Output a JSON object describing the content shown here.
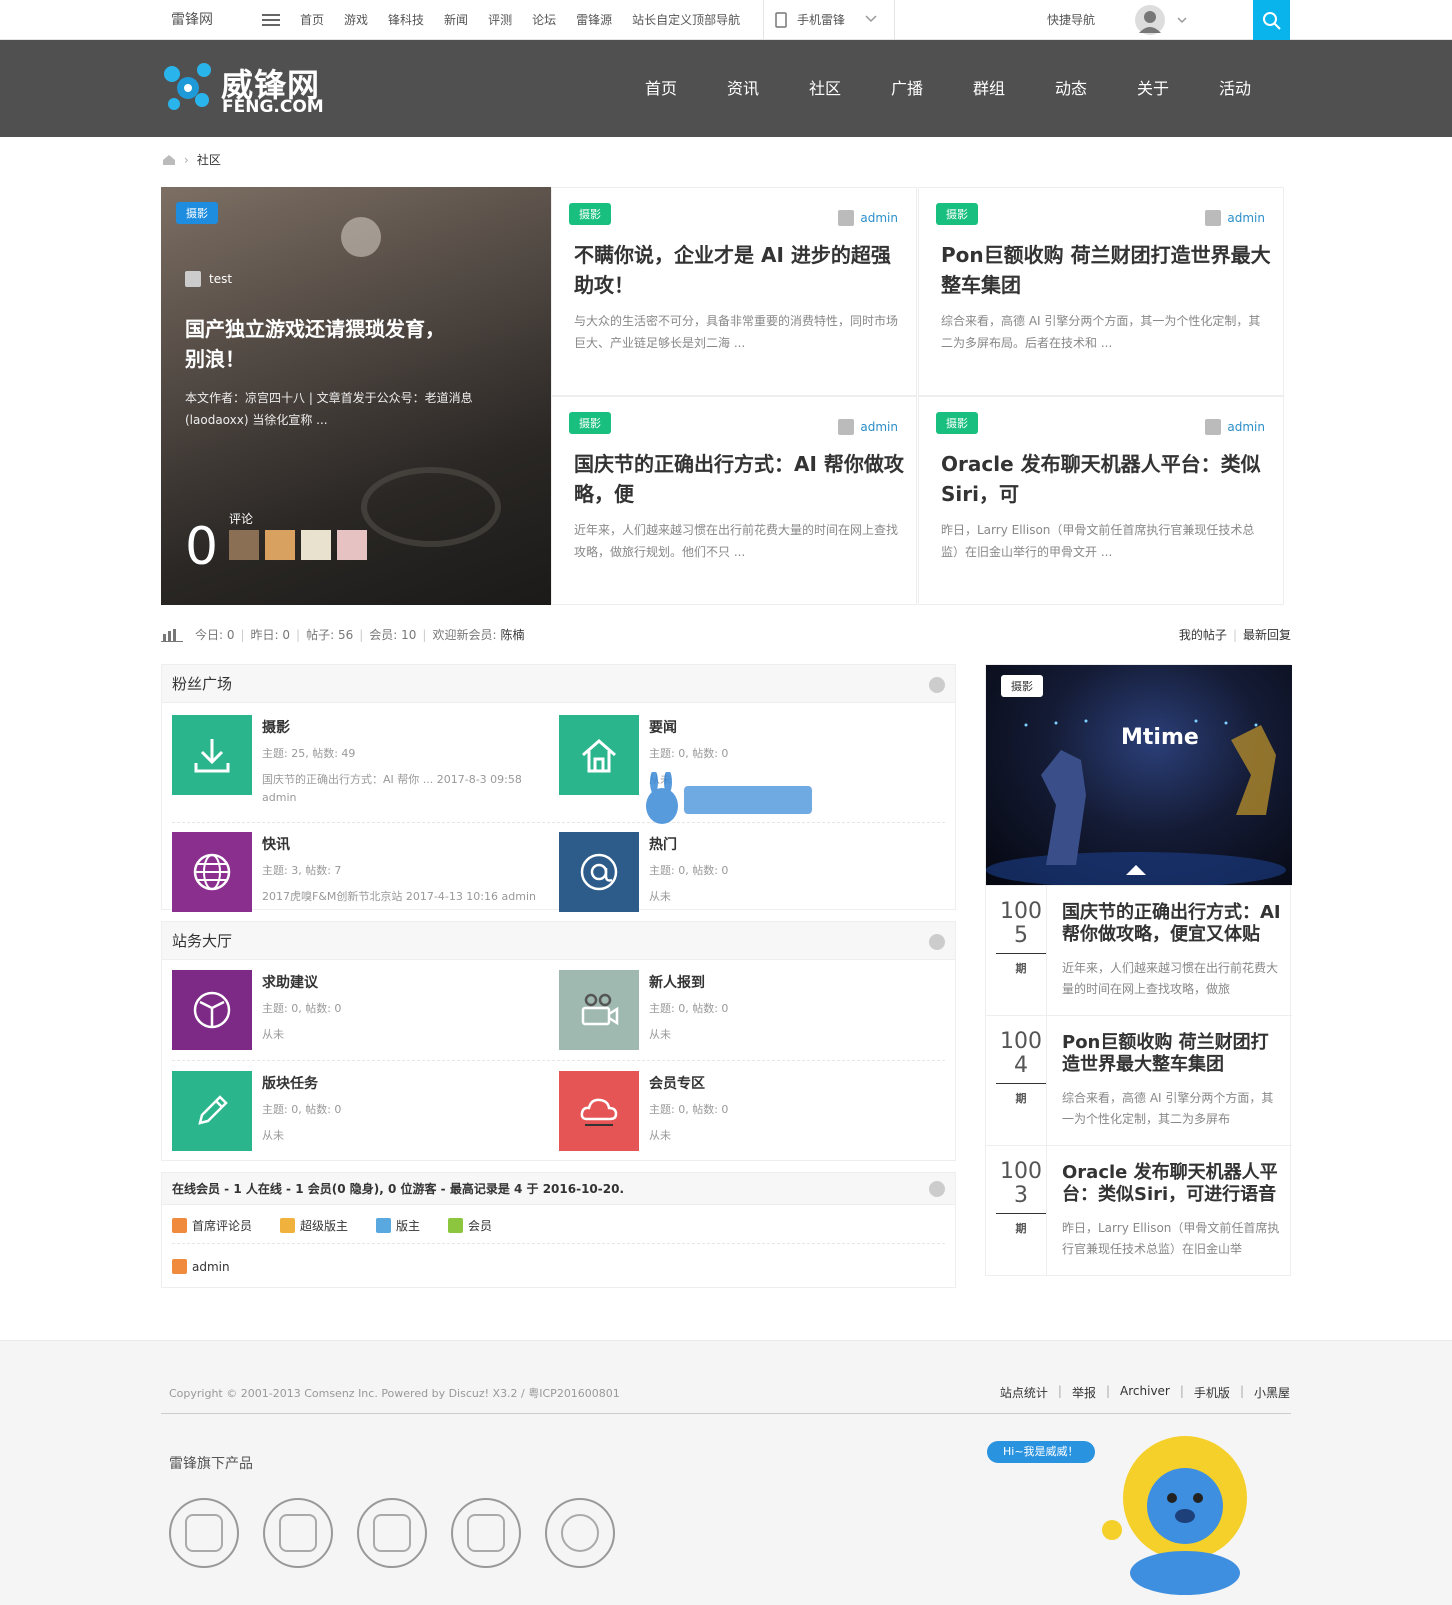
{
  "topbar": {
    "site": "雷锋网",
    "nav": [
      "首页",
      "游戏",
      "锋科技",
      "新闻",
      "评测",
      "论坛",
      "雷锋源",
      "站长自定义顶部导航"
    ],
    "mobile": "手机雷锋",
    "quicknav": "快捷导航"
  },
  "header": {
    "logo_cn": "威锋网",
    "logo_en": "FENG.COM",
    "nav": [
      "首页",
      "资讯",
      "社区",
      "广播",
      "群组",
      "动态",
      "关于",
      "活动"
    ]
  },
  "breadcrumb": {
    "current": "社区"
  },
  "hero": {
    "tag": "摄影",
    "author": "test",
    "title": "国产独立游戏还请猥琐发育，别浪！",
    "desc": "本文作者：凉宫四十八 | 文章首发于公众号：老道消息(laodaoxx) 当徐化宣称 ...",
    "comment_label": "评论",
    "comment_count": "0"
  },
  "cards": [
    {
      "tag": "摄影",
      "author": "admin",
      "title": "不瞒你说，企业才是 AI 进步的超强助攻！",
      "desc": "与大众的生活密不可分，具备非常重要的消费特性，同时市场巨大、产业链足够长是刘二海 ..."
    },
    {
      "tag": "摄影",
      "author": "admin",
      "title": "Pon巨额收购 荷兰财团打造世界最大整车集团",
      "desc": "综合来看，高德 AI 引擎分两个方面，其一为个性化定制，其二为多屏布局。后者在技术和 ..."
    },
    {
      "tag": "摄影",
      "author": "admin",
      "title": "国庆节的正确出行方式：AI 帮你做攻略，便",
      "desc": "近年来，人们越来越习惯在出行前花费大量的时间在网上查找攻略，做旅行规划。他们不只 ..."
    },
    {
      "tag": "摄影",
      "author": "admin",
      "title": "Oracle 发布聊天机器人平台：类似 Siri，可",
      "desc": "昨日，Larry Ellison（甲骨文前任首席执行官兼现任技术总监）在旧金山举行的甲骨文开 ..."
    }
  ],
  "stats": {
    "today": "今日: 0",
    "yesterday": "昨日: 0",
    "posts": "帖子: 56",
    "members": "会员: 10",
    "welcome": "欢迎新会员:",
    "newest": "陈楠",
    "my_posts": "我的帖子",
    "latest_reply": "最新回复"
  },
  "groups": [
    {
      "title": "粉丝广场",
      "forums": [
        {
          "name": "摄影",
          "stat": "主题: 25, 帖数: 49",
          "last": "国庆节的正确出行方式：AI 帮你 ... 2017-8-3 09:58 admin",
          "color": "#2bb58c",
          "icon": "download-icon"
        },
        {
          "name": "要闻",
          "stat": "主题: 0, 帖数: 0",
          "last": "从未",
          "color": "#2bb58c",
          "icon": "home-icon"
        },
        {
          "name": "快讯",
          "stat": "主题: 3, 帖数: 7",
          "last": "2017虎嗅F&M创新节北京站 2017-4-13 10:16 admin",
          "color": "#8b2f8f",
          "icon": "globe-icon"
        },
        {
          "name": "热门",
          "stat": "主题: 0, 帖数: 0",
          "last": "从未",
          "color": "#2d5c8a",
          "icon": "at-icon"
        }
      ]
    },
    {
      "title": "站务大厅",
      "forums": [
        {
          "name": "求助建议",
          "stat": "主题: 0, 帖数: 0",
          "last": "从未",
          "color": "#7d2a86",
          "icon": "shield-icon"
        },
        {
          "name": "新人报到",
          "stat": "主题: 0, 帖数: 0",
          "last": "从未",
          "color": "#9fb9b1",
          "icon": "camera-icon"
        },
        {
          "name": "版块任务",
          "stat": "主题: 0, 帖数: 0",
          "last": "从未",
          "color": "#2bb58c",
          "icon": "pencil-icon"
        },
        {
          "name": "会员专区",
          "stat": "主题: 0, 帖数: 0",
          "last": "从未",
          "color": "#e55555",
          "icon": "cloud-icon"
        }
      ]
    }
  ],
  "online": {
    "title": "在线会员 - 1 人在线 - 1 会员(0 隐身), 0 位游客 - 最高记录是 4 于 2016-10-20.",
    "legend": [
      {
        "label": "首席评论员",
        "color": "#f08a3c"
      },
      {
        "label": "超级版主",
        "color": "#f0b23c"
      },
      {
        "label": "版主",
        "color": "#5aa8e0"
      },
      {
        "label": "会员",
        "color": "#8cc63f"
      }
    ],
    "user": "admin"
  },
  "side": {
    "tag": "摄影",
    "banner": "Mtime",
    "items": [
      {
        "num1": "100",
        "num2": "5",
        "unit": "期",
        "title": "国庆节的正确出行方式：AI 帮你做攻略，便宜又体贴",
        "desc": "近年来，人们越来越习惯在出行前花费大量的时间在网上查找攻略，做旅"
      },
      {
        "num1": "100",
        "num2": "4",
        "unit": "期",
        "title": "Pon巨额收购 荷兰财团打造世界最大整车集团",
        "desc": "综合来看，高德 AI 引擎分两个方面，其一为个性化定制，其二为多屏布"
      },
      {
        "num1": "100",
        "num2": "3",
        "unit": "期",
        "title": "Oracle 发布聊天机器人平台：类似Siri，可进行语音",
        "desc": "昨日，Larry Ellison（甲骨文前任首席执行官兼现任技术总监）在旧金山举"
      }
    ]
  },
  "footer": {
    "copyright": "Copyright © 2001-2013 Comsenz Inc. Powered by Discuz! X3.2 / 粤ICP201600801",
    "links": [
      "站点统计",
      "举报",
      "Archiver",
      "手机版",
      "小黑屋"
    ],
    "products_title": "雷锋旗下产品",
    "mascot_bubble": "Hi~我是威威！"
  }
}
